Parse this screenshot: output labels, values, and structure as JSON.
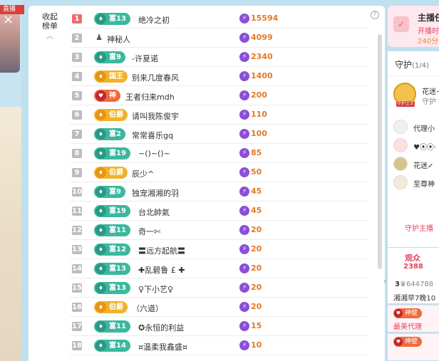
{
  "left": {
    "tag": "直播"
  },
  "panel": {
    "collapse_label": "收起榜单",
    "help_icon": "?",
    "rows": [
      {
        "rank": "1",
        "badge": {
          "text": "富13",
          "type": "green",
          "icon": "♦"
        },
        "name": "绝冷之初",
        "score": "15594"
      },
      {
        "rank": "2",
        "badge": null,
        "anon": true,
        "name": "神秘人",
        "score": "4099"
      },
      {
        "rank": "3",
        "badge": {
          "text": "富9",
          "type": "green",
          "icon": "♦"
        },
        "name": "-许夏诺",
        "score": "2340"
      },
      {
        "rank": "4",
        "badge": {
          "text": "国王",
          "type": "gold",
          "icon": "♦"
        },
        "name": "别来几度春风",
        "score": "1400"
      },
      {
        "rank": "5",
        "badge": {
          "text": "神",
          "type": "red",
          "icon": "♥"
        },
        "name": "王者归来mdh",
        "score": "200"
      },
      {
        "rank": "6",
        "badge": {
          "text": "伯爵",
          "type": "gold",
          "icon": "♦"
        },
        "name": "请叫我陈俊宇",
        "score": "110"
      },
      {
        "rank": "7",
        "badge": {
          "text": "富2",
          "type": "green",
          "icon": "♦"
        },
        "name": "常常喜乐gq",
        "score": "100"
      },
      {
        "rank": "8",
        "badge": {
          "text": "富19",
          "type": "green",
          "icon": "♦"
        },
        "name": "~()~()~",
        "score": "85"
      },
      {
        "rank": "9",
        "badge": {
          "text": "伯爵",
          "type": "gold",
          "icon": "♦"
        },
        "name": "辰少^",
        "score": "50"
      },
      {
        "rank": "10",
        "badge": {
          "text": "富9",
          "type": "green",
          "icon": "♦"
        },
        "name": "独宠湘湘的羽",
        "score": "45"
      },
      {
        "rank": "11",
        "badge": {
          "text": "富19",
          "type": "green",
          "icon": "♦"
        },
        "name": "台北帥氣",
        "score": "45"
      },
      {
        "rank": "12",
        "badge": {
          "text": "富11",
          "type": "green",
          "icon": "♦"
        },
        "name": "奇一✄",
        "score": "20"
      },
      {
        "rank": "13",
        "badge": {
          "text": "富12",
          "type": "green",
          "icon": "♦"
        },
        "name": "〓远方起航〓",
        "score": "20"
      },
      {
        "rank": "14",
        "badge": {
          "text": "富13",
          "type": "green",
          "icon": "♦"
        },
        "name": "✚乱碧鲁 £ ✚",
        "score": "20"
      },
      {
        "rank": "15",
        "badge": {
          "text": "富13",
          "type": "green",
          "icon": "♦"
        },
        "name": "♀下小艺♀",
        "score": "20"
      },
      {
        "rank": "16",
        "badge": {
          "text": "伯爵",
          "type": "gold",
          "icon": "♦"
        },
        "name": "（六道）",
        "score": "20"
      },
      {
        "rank": "17",
        "badge": {
          "text": "富11",
          "type": "green",
          "icon": "♦"
        },
        "name": "✪永恒的利益",
        "score": "15"
      },
      {
        "rank": "18",
        "badge": {
          "text": "富14",
          "type": "green",
          "icon": "♦"
        },
        "name": "¤温柔我鑫盛¤",
        "score": "10"
      }
    ]
  },
  "right": {
    "host_card": {
      "title": "主播任",
      "line1": "开播时",
      "line2": "240分"
    },
    "guard": {
      "title": "守护",
      "count": "(1/4)",
      "top_name": "花迷~",
      "top_sub": "守护",
      "top_badge": "守护之王",
      "items": [
        "代理小",
        "♥⦿⦿·",
        "花迷✓",
        "至尊神"
      ],
      "button": "守护主播"
    },
    "audience": {
      "label": "观众",
      "count": "2388",
      "id_prefix": "3",
      "id_value": "644788",
      "line": "湘湘早7晚10"
    },
    "messages": [
      {
        "pill": "神壁",
        "text": "最美代理"
      },
      {
        "pill": "神壁",
        "text": ""
      }
    ]
  },
  "colors": {
    "accent_pink": "#e7445f",
    "score_orange": "#e07a2a",
    "badge_green": "#3bb89f",
    "badge_gold": "#f1b22b",
    "badge_red": "#ef6a3c",
    "lightning_purple": "#8a4fd6"
  }
}
